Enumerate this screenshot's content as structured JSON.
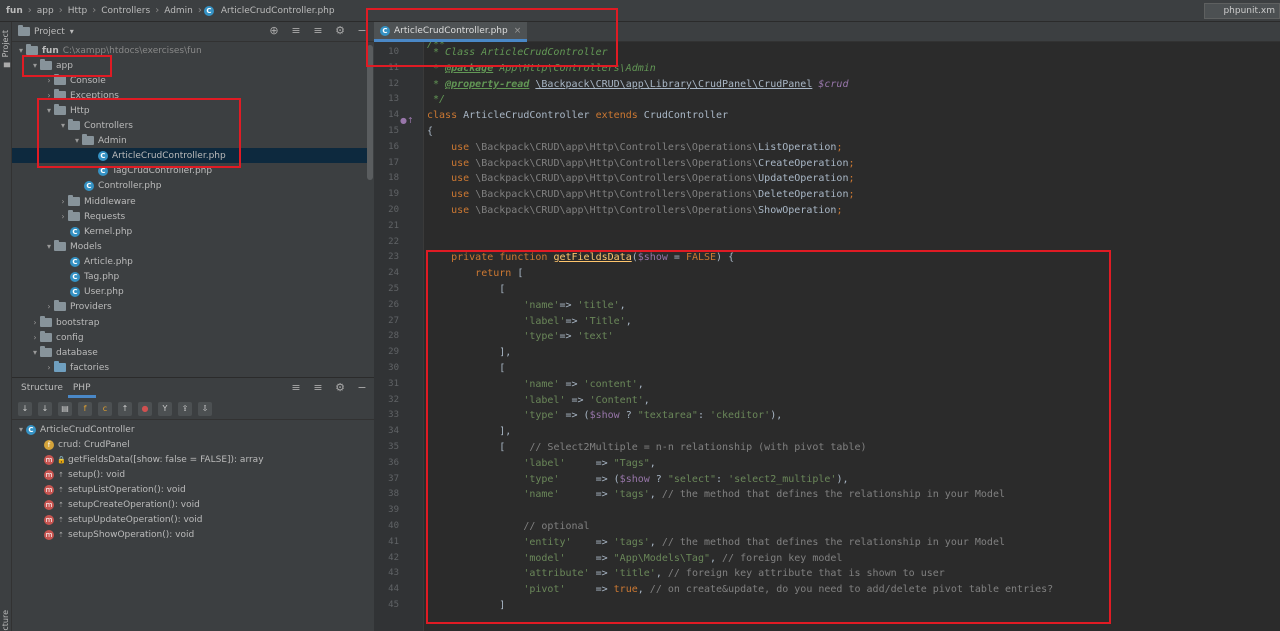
{
  "breadcrumb": [
    "fun",
    "app",
    "Http",
    "Controllers",
    "Admin",
    "ArticleCrudController.php"
  ],
  "top_right_tab": "phpunit.xm",
  "left_strip": {
    "project_label": "Project",
    "structure_label": "ucture"
  },
  "project_panel": {
    "title": "Project",
    "root": {
      "name": "fun",
      "path": "C:\\xampp\\htdocs\\exercises\\fun"
    },
    "items": [
      {
        "label": "app"
      },
      {
        "label": "Console"
      },
      {
        "label": "Exceptions"
      },
      {
        "label": "Http"
      },
      {
        "label": "Controllers"
      },
      {
        "label": "Admin"
      },
      {
        "label": "ArticleCrudController.php"
      },
      {
        "label": "TagCrudController.php"
      },
      {
        "label": "Controller.php"
      },
      {
        "label": "Middleware"
      },
      {
        "label": "Requests"
      },
      {
        "label": "Kernel.php"
      },
      {
        "label": "Models"
      },
      {
        "label": "Article.php"
      },
      {
        "label": "Tag.php"
      },
      {
        "label": "User.php"
      },
      {
        "label": "Providers"
      },
      {
        "label": "bootstrap"
      },
      {
        "label": "config"
      },
      {
        "label": "database"
      },
      {
        "label": "factories"
      }
    ]
  },
  "structure_panel": {
    "tabs": [
      "Structure",
      "PHP"
    ],
    "class_name": "ArticleCrudController",
    "members": [
      {
        "icon": "f",
        "label": "crud: CrudPanel"
      },
      {
        "icon": "m",
        "label": "getFieldsData([show: false = FALSE]): array"
      },
      {
        "icon": "m",
        "label": "setup(): void"
      },
      {
        "icon": "m",
        "label": "setupListOperation(): void"
      },
      {
        "icon": "m",
        "label": "setupCreateOperation(): void"
      },
      {
        "icon": "m",
        "label": "setupUpdateOperation(): void"
      },
      {
        "icon": "m",
        "label": "setupShowOperation(): void"
      }
    ]
  },
  "editor": {
    "tab_label": "ArticleCrudController.php",
    "line_numbers": [
      "10",
      "11",
      "12",
      "13",
      "14",
      "15",
      "16",
      "17",
      "18",
      "19",
      "20",
      "21",
      "22",
      "23",
      "24",
      "25",
      "26",
      "27",
      "28",
      "29",
      "30",
      "31",
      "32",
      "33",
      "34",
      "35",
      "36",
      "37",
      "38",
      "39",
      "40",
      "41",
      "42",
      "43",
      "44",
      "45"
    ],
    "code": {
      "l9": "/**",
      "l10": " * Class ArticleCrudController",
      "l11_tag": "@package",
      "l11_rest": " App\\Http\\Controllers\\Admin",
      "l12_tag": "@property-read",
      "l12_type": "\\Backpack\\CRUD\\app\\Library\\CrudPanel\\CrudPanel",
      "l12_var": "$crud",
      "l13": " */",
      "l14_kw1": "class",
      "l14_name": "ArticleCrudController",
      "l14_kw2": "extends",
      "l14_parent": "CrudController",
      "l15": "{",
      "use_kw": "use",
      "use_ns": "\\Backpack\\CRUD\\app\\Http\\Controllers\\Operations\\",
      "uses": [
        "ListOperation",
        "CreateOperation",
        "UpdateOperation",
        "DeleteOperation",
        "ShowOperation"
      ],
      "l23_kw": "private function",
      "l23_fn": "getFieldsData",
      "l23_var": "$show",
      "l23_def": "FALSE",
      "l24_kw": "return",
      "k_name": "'name'",
      "k_label": "'label'",
      "k_type": "'type'",
      "v_title": "'title'",
      "v_Title": "'Title'",
      "v_text": "'text'",
      "v_content": "'content'",
      "v_Content": "'Content'",
      "v_textarea": "\"textarea\"",
      "v_ckeditor": "'ckeditor'",
      "c_select2": "// Select2Multiple = n-n relationship (with pivot table)",
      "v_Tags": "\"Tags\"",
      "v_select": "\"select\"",
      "v_select2m": "'select2_multiple'",
      "v_tags": "'tags'",
      "c_method": "// the method that defines the relationship in your Model",
      "c_optional": "// optional",
      "k_entity": "'entity'",
      "k_model": "'model'",
      "v_model": "\"App\\Models\\Tag\"",
      "c_fk": "// foreign key model",
      "k_attribute": "'attribute'",
      "c_attr": "// foreign key attribute that is shown to user",
      "k_pivot": "'pivot'",
      "v_true": "true",
      "c_pivot": "// on create&update, do you need to add/delete pivot table entries?"
    }
  }
}
